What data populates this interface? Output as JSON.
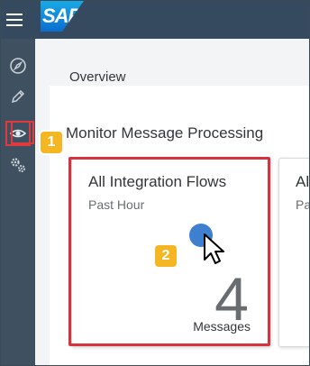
{
  "header": {
    "menu_icon": "hamburger-icon",
    "logo_text": "SAP"
  },
  "sidebar": {
    "items": [
      {
        "icon": "compass-icon",
        "active": false
      },
      {
        "icon": "pencil-icon",
        "active": false
      },
      {
        "icon": "eye-icon",
        "active": true
      },
      {
        "icon": "settings-gears-icon",
        "active": false
      }
    ]
  },
  "breadcrumb": {
    "label": "Overview"
  },
  "section": {
    "title": "Monitor Message Processing"
  },
  "tiles": [
    {
      "title": "All Integration Flows",
      "subtitle": "Past Hour",
      "count": "4",
      "unit": "Messages"
    },
    {
      "title": "Al",
      "subtitle": "Pa"
    }
  ],
  "annotations": {
    "step1": "1",
    "step2": "2"
  },
  "colors": {
    "header_bg": "#354a5f",
    "sidebar_bg": "#3f5161",
    "highlight_red": "#d9323f",
    "badge_yellow": "#f4b723",
    "click_dot_blue": "#3f7fd0"
  }
}
